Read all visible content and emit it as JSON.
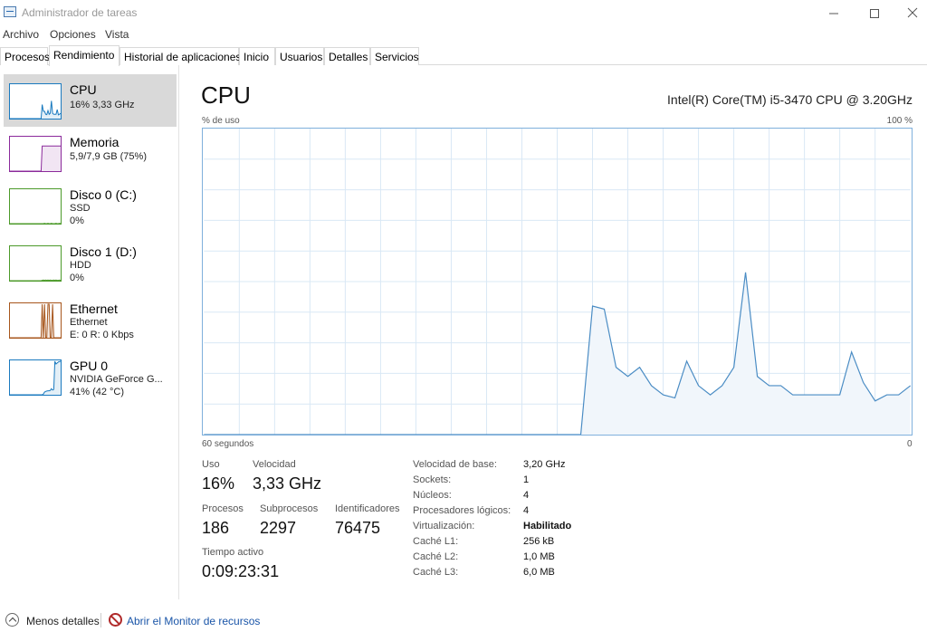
{
  "window": {
    "title": "Administrador de tareas",
    "minimize_icon": "minimize-icon",
    "maximize_icon": "maximize-icon",
    "close_icon": "close-icon"
  },
  "menu": [
    "Archivo",
    "Opciones",
    "Vista"
  ],
  "tabs": [
    "Procesos",
    "Rendimiento",
    "Historial de aplicaciones",
    "Inicio",
    "Usuarios",
    "Detalles",
    "Servicios"
  ],
  "active_tab": "Rendimiento",
  "sidebar": {
    "items": [
      {
        "title": "CPU",
        "lines": [
          "16% 3,33 GHz"
        ],
        "color": "#1a7abf",
        "selected": true
      },
      {
        "title": "Memoria",
        "lines": [
          "5,9/7,9 GB (75%)"
        ],
        "color": "#8b2a9b",
        "selected": false
      },
      {
        "title": "Disco 0 (C:)",
        "lines": [
          "SSD",
          "0%"
        ],
        "color": "#4c9a2a",
        "selected": false
      },
      {
        "title": "Disco 1 (D:)",
        "lines": [
          "HDD",
          "0%"
        ],
        "color": "#4c9a2a",
        "selected": false
      },
      {
        "title": "Ethernet",
        "lines": [
          "Ethernet",
          "E: 0 R: 0 Kbps"
        ],
        "color": "#a7561c",
        "selected": false
      },
      {
        "title": "GPU 0",
        "lines": [
          "NVIDIA GeForce G...",
          "41% (42 °C)"
        ],
        "color": "#1a7abf",
        "selected": false
      }
    ]
  },
  "main": {
    "title": "CPU",
    "model": "Intel(R) Core(TM) i5-3470 CPU @ 3.20GHz",
    "y_axis_label": "% de uso",
    "y_axis_max": "100 %",
    "x_axis_label": "60 segundos",
    "x_axis_min": "0"
  },
  "chart_data": {
    "type": "area",
    "x": [
      60,
      59,
      58,
      57,
      56,
      55,
      54,
      53,
      52,
      51,
      50,
      49,
      48,
      47,
      46,
      45,
      44,
      43,
      42,
      41,
      40,
      39,
      38,
      37,
      36,
      35,
      34,
      33,
      32,
      31,
      30,
      29,
      28,
      27,
      26,
      25,
      24,
      23,
      22,
      21,
      20,
      19,
      18,
      17,
      16,
      15,
      14,
      13,
      12,
      11,
      10,
      9,
      8,
      7,
      6,
      5,
      4,
      3,
      2,
      1,
      0
    ],
    "y": [
      0,
      0,
      0,
      0,
      0,
      0,
      0,
      0,
      0,
      0,
      0,
      0,
      0,
      0,
      0,
      0,
      0,
      0,
      0,
      0,
      0,
      0,
      0,
      0,
      0,
      0,
      0,
      0,
      0,
      0,
      0,
      0,
      0,
      42,
      41,
      22,
      19,
      22,
      16,
      13,
      12,
      24,
      16,
      13,
      16,
      22,
      53,
      19,
      16,
      16,
      13,
      13,
      13,
      13,
      13,
      27,
      17,
      11,
      13,
      13,
      16
    ],
    "xlabel": "60 segundos",
    "ylabel": "% de uso",
    "ylim": [
      0,
      100
    ],
    "grid": true,
    "color": "#4a8cc4",
    "fill": "#f1f6fb"
  },
  "sparklines": {
    "cpu": [
      0,
      0,
      0,
      0,
      0,
      0,
      0,
      0,
      0,
      0,
      0,
      0,
      0,
      0,
      0,
      0,
      0,
      0,
      0,
      0,
      0,
      0,
      0,
      0,
      0,
      0,
      0,
      0,
      42,
      22,
      22,
      13,
      12,
      24,
      13,
      16,
      53,
      16,
      13,
      13,
      13,
      27,
      11,
      13,
      16
    ],
    "memoria": [
      0,
      0,
      0,
      0,
      0,
      0,
      0,
      0,
      0,
      0,
      0,
      0,
      0,
      0,
      0,
      0,
      0,
      0,
      0,
      0,
      0,
      0,
      0,
      0,
      0,
      0,
      0,
      0,
      75,
      75,
      75,
      75,
      75,
      75,
      75,
      75,
      75,
      75,
      75,
      75,
      75,
      75,
      75,
      75,
      75
    ],
    "disco0": [
      0,
      0,
      0,
      0,
      0,
      0,
      0,
      0,
      0,
      0,
      0,
      0,
      0,
      0,
      0,
      0,
      0,
      0,
      0,
      0,
      0,
      0,
      0,
      0,
      0,
      0,
      0,
      0,
      0,
      0,
      1,
      0,
      0,
      1,
      0,
      0,
      1,
      0,
      0,
      0,
      1,
      0,
      0,
      1,
      0
    ],
    "disco1": [
      0,
      0,
      0,
      0,
      0,
      0,
      0,
      0,
      0,
      0,
      0,
      0,
      0,
      0,
      0,
      0,
      0,
      0,
      0,
      0,
      0,
      0,
      0,
      0,
      0,
      0,
      0,
      0,
      1,
      2,
      1,
      2,
      1,
      2,
      1,
      2,
      1,
      1,
      2,
      1,
      2,
      1,
      1,
      2,
      1
    ],
    "ethernet": [
      0,
      0,
      0,
      0,
      0,
      0,
      0,
      0,
      0,
      0,
      0,
      0,
      0,
      0,
      0,
      0,
      0,
      0,
      0,
      0,
      0,
      0,
      0,
      0,
      0,
      0,
      0,
      0,
      100,
      0,
      100,
      0,
      0,
      100,
      100,
      0,
      0,
      100,
      0,
      0,
      0,
      0,
      0,
      0,
      0
    ],
    "gpu": [
      0,
      0,
      0,
      0,
      0,
      0,
      0,
      0,
      0,
      0,
      0,
      0,
      0,
      0,
      0,
      0,
      0,
      0,
      0,
      0,
      0,
      0,
      0,
      0,
      0,
      0,
      0,
      0,
      0,
      2,
      8,
      10,
      11,
      12,
      12,
      13,
      18,
      14,
      16,
      100,
      92,
      95,
      98,
      99,
      100
    ]
  },
  "stats": {
    "uso_label": "Uso",
    "uso_value": "16%",
    "velocidad_label": "Velocidad",
    "velocidad_value": "3,33 GHz",
    "procesos_label": "Procesos",
    "procesos_value": "186",
    "subprocesos_label": "Subprocesos",
    "subprocesos_value": "2297",
    "identificadores_label": "Identificadores",
    "identificadores_value": "76475",
    "tiempo_label": "Tiempo activo",
    "tiempo_value": "0:09:23:31"
  },
  "info": [
    {
      "key": "Velocidad de base:",
      "value": "3,20 GHz"
    },
    {
      "key": "Sockets:",
      "value": "1"
    },
    {
      "key": "Núcleos:",
      "value": "4"
    },
    {
      "key": "Procesadores lógicos:",
      "value": "4"
    },
    {
      "key": "Virtualización:",
      "value": "Habilitado",
      "bold": true
    },
    {
      "key": "Caché L1:",
      "value": "256 kB"
    },
    {
      "key": "Caché L2:",
      "value": "1,0 MB"
    },
    {
      "key": "Caché L3:",
      "value": "6,0 MB"
    }
  ],
  "footer": {
    "less_details": "Menos detalles",
    "resource_monitor": "Abrir el Monitor de recursos"
  }
}
